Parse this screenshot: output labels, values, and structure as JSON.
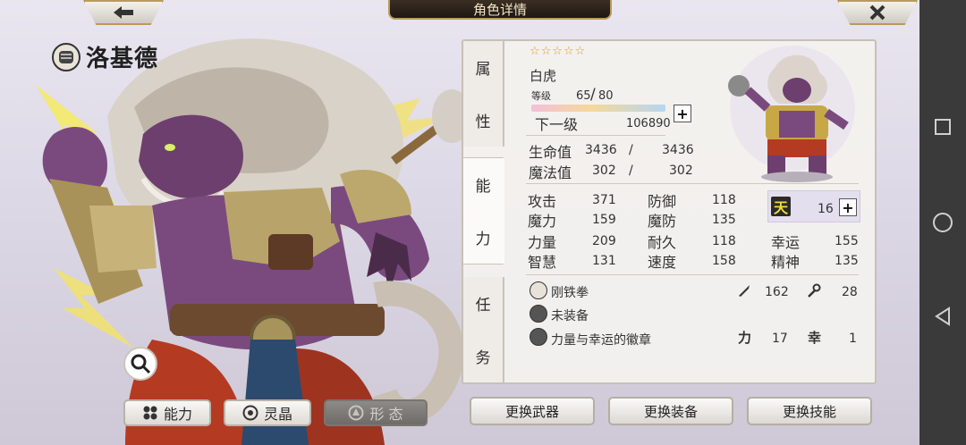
{
  "header": {
    "title": "角色详情"
  },
  "character": {
    "name": "洛基德"
  },
  "panel": {
    "tabs": [
      "属",
      "性",
      "能",
      "力",
      "任",
      "务"
    ],
    "stars": "☆☆☆☆☆",
    "race": "白虎",
    "level_label": "等级",
    "level_value": "65",
    "level_max": "80",
    "level_sep": "/",
    "next_label": "下一级",
    "next_value": "106890",
    "hp_label": "生命值",
    "hp_cur": "3436",
    "hp_max": "3436",
    "mp_label": "魔法值",
    "mp_cur": "302",
    "mp_max": "302",
    "sep": "/",
    "stats": {
      "atk_label": "攻击",
      "atk": "371",
      "def_label": "防御",
      "def": "118",
      "mag_label": "魔力",
      "mag": "159",
      "mdef_label": "魔防",
      "mdef": "135",
      "str_label": "力量",
      "str": "209",
      "vit_label": "耐久",
      "vit": "118",
      "luck_label": "幸运",
      "luck": "155",
      "int_label": "智慧",
      "int": "131",
      "spd_label": "速度",
      "spd": "158",
      "spi_label": "精神",
      "spi": "135"
    },
    "heaven_glyph": "天",
    "heaven_value": "16",
    "equipment": [
      {
        "name": "刚铁拳",
        "v1": "162",
        "v2": "28"
      },
      {
        "name": "未装备"
      },
      {
        "name": "力量与幸运的徽章",
        "k1": "力",
        "v1": "17",
        "k2": "幸",
        "v2": "1"
      }
    ]
  },
  "bottom_tabs": [
    "能力",
    "灵晶",
    "形 态"
  ],
  "actions": [
    "更换武器",
    "更换装备",
    "更换技能"
  ],
  "colors": {
    "gold": "#b99a5a",
    "star": "#d39b2c"
  }
}
